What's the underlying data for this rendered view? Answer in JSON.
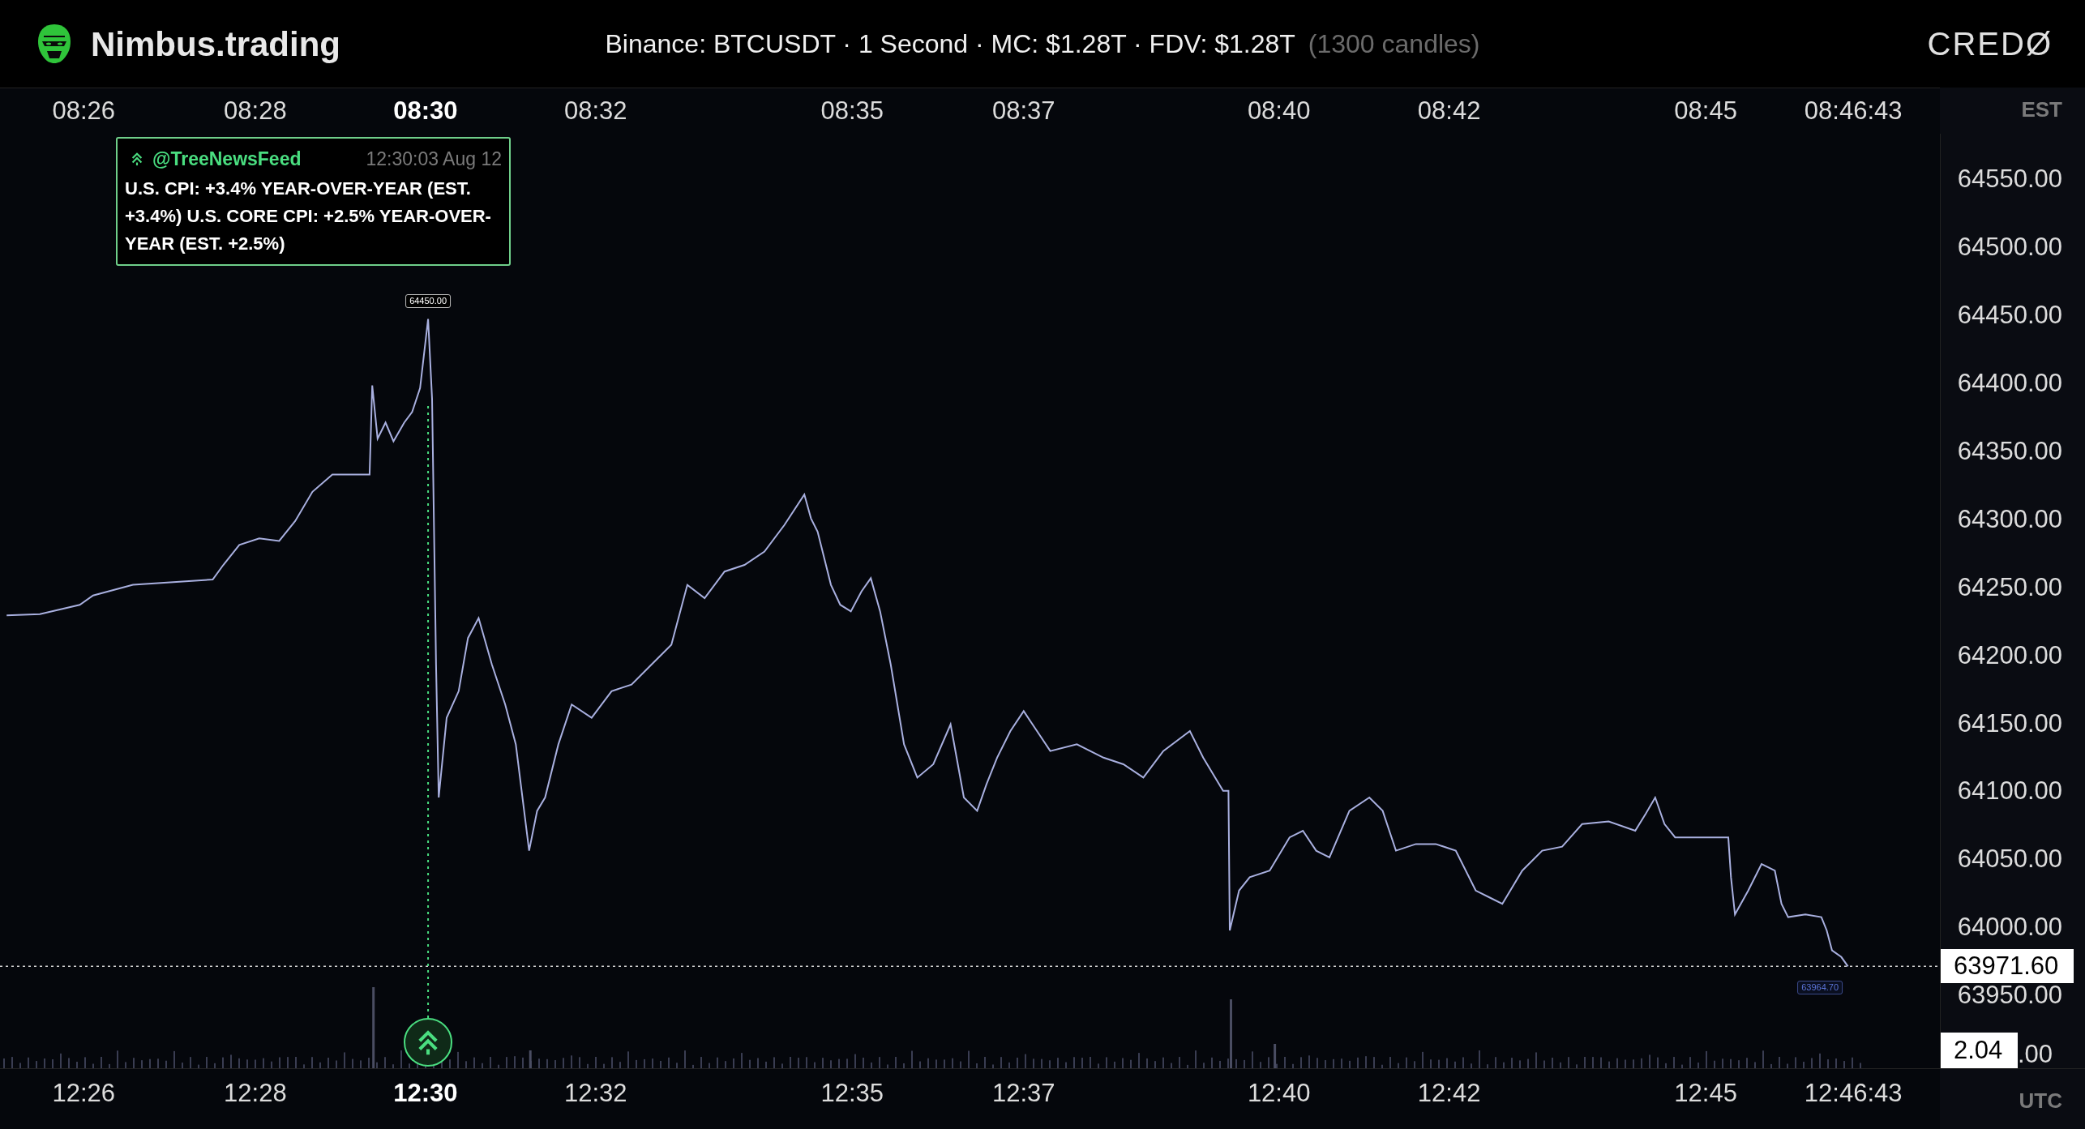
{
  "header": {
    "title": "Nimbus.trading",
    "info": "Binance: BTCUSDT · 1 Second · MC: $1.28T · FDV: $1.28T",
    "candles": "(1300 candles)",
    "logo": "CREDØ"
  },
  "top_axis": {
    "zone": "EST",
    "ticks": [
      {
        "label": "08:26",
        "highlighted": false
      },
      {
        "label": "08:28",
        "highlighted": false
      },
      {
        "label": "08:30",
        "highlighted": true
      },
      {
        "label": "08:32",
        "highlighted": false
      },
      {
        "label": "08:35",
        "highlighted": false
      },
      {
        "label": "08:37",
        "highlighted": false
      },
      {
        "label": "08:40",
        "highlighted": false
      },
      {
        "label": "08:42",
        "highlighted": false
      },
      {
        "label": "08:45",
        "highlighted": false
      },
      {
        "label": "08:46:43",
        "highlighted": false
      }
    ]
  },
  "news": {
    "source": "@TreeNewsFeed",
    "time": "12:30:03 Aug 12",
    "text": "U.S. CPI: +3.4% YEAR-OVER-YEAR (EST. +3.4%) U.S. CORE CPI: +2.5% YEAR-OVER-YEAR (EST. +2.5%)"
  },
  "chart": {
    "high_label": "64450.00",
    "low_label": "63964.70",
    "current_price": "63971.60",
    "volume_value": "2.04",
    "volume_tick": ".00",
    "price_axis": [
      "64550.00",
      "64500.00",
      "64450.00",
      "64400.00",
      "64350.00",
      "64300.00",
      "64250.00",
      "64200.00",
      "64150.00",
      "64100.00",
      "64050.00",
      "64000.00",
      "63950.00"
    ],
    "bottom_axis": {
      "zone": "UTC",
      "ticks": [
        {
          "label": "12:26",
          "highlighted": false
        },
        {
          "label": "12:28",
          "highlighted": false
        },
        {
          "label": "12:30",
          "highlighted": true
        },
        {
          "label": "12:32",
          "highlighted": false
        },
        {
          "label": "12:35",
          "highlighted": false
        },
        {
          "label": "12:37",
          "highlighted": false
        },
        {
          "label": "12:40",
          "highlighted": false
        },
        {
          "label": "12:42",
          "highlighted": false
        },
        {
          "label": "12:45",
          "highlighted": false
        },
        {
          "label": "12:46:43",
          "highlighted": false
        }
      ]
    }
  }
}
